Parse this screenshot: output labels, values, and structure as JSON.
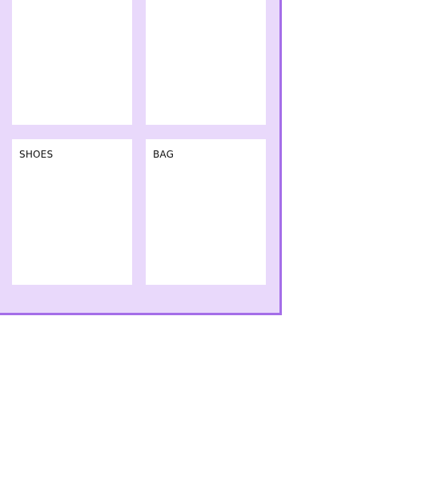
{
  "grid": {
    "cards": [
      {
        "label": ""
      },
      {
        "label": ""
      },
      {
        "label": "SHOES"
      },
      {
        "label": "BAG"
      }
    ]
  },
  "colors": {
    "panel_background": "#e9d9fb",
    "panel_border": "#a46ee8",
    "card_background": "#ffffff"
  }
}
